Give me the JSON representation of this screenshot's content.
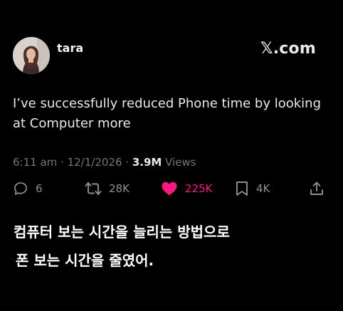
{
  "tweet": {
    "author": {
      "name": "tara",
      "handle": ""
    },
    "brand": "𝕏.com",
    "text_lines": [
      "I’ve successfully reduced Phone time by looking",
      "at Computer more"
    ],
    "meta": {
      "time": "6:11 am",
      "separator_1": " · ",
      "date": "12/1/2026",
      "separator_2": " · ",
      "views_count": "3.9M",
      "views_label": " Views"
    },
    "actions": {
      "replies": "6",
      "retweets": "28K",
      "likes": "225K",
      "bookmarks": "4K"
    },
    "colors": {
      "like": "#f91880",
      "muted": "#71767b",
      "text": "#e7e9ea"
    },
    "icons": [
      "reply-icon",
      "retweet-icon",
      "heart-icon",
      "bookmark-icon",
      "share-icon"
    ]
  },
  "caption": {
    "line1": "컴퓨터 보는 시간을 늘리는 방법으로",
    "line2": "폰 보는 시간을 줄였어."
  }
}
